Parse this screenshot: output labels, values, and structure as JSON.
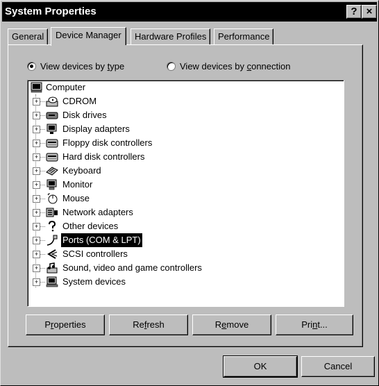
{
  "window": {
    "title": "System Properties"
  },
  "titlebar_buttons": {
    "help": "?",
    "close": "×"
  },
  "tabs": [
    {
      "label": "General"
    },
    {
      "label": "Device Manager"
    },
    {
      "label": "Hardware Profiles"
    },
    {
      "label": "Performance"
    }
  ],
  "view": {
    "by_type": {
      "pre": "View devices by ",
      "accel": "t",
      "post": "ype",
      "selected": true
    },
    "by_connection": {
      "pre": "View devices by ",
      "accel": "c",
      "post": "onnection",
      "selected": false
    }
  },
  "tree": {
    "root": {
      "label": "Computer",
      "icon": "computer-icon"
    },
    "items": [
      {
        "label": "CDROM",
        "icon": "cdrom-icon"
      },
      {
        "label": "Disk drives",
        "icon": "disk-drive-icon"
      },
      {
        "label": "Display adapters",
        "icon": "display-adapter-icon"
      },
      {
        "label": "Floppy disk controllers",
        "icon": "floppy-controller-icon"
      },
      {
        "label": "Hard disk controllers",
        "icon": "hard-disk-controller-icon"
      },
      {
        "label": "Keyboard",
        "icon": "keyboard-icon"
      },
      {
        "label": "Monitor",
        "icon": "monitor-icon"
      },
      {
        "label": "Mouse",
        "icon": "mouse-icon"
      },
      {
        "label": "Network adapters",
        "icon": "network-adapter-icon"
      },
      {
        "label": "Other devices",
        "icon": "question-mark-icon"
      },
      {
        "label": "Ports (COM & LPT)",
        "icon": "port-icon",
        "selected": true
      },
      {
        "label": "SCSI controllers",
        "icon": "scsi-icon"
      },
      {
        "label": "Sound, video and game controllers",
        "icon": "sound-icon"
      },
      {
        "label": "System devices",
        "icon": "system-devices-icon"
      }
    ]
  },
  "buttons": {
    "properties": {
      "pre": "P",
      "accel": "r",
      "post": "operties"
    },
    "refresh": {
      "pre": "Re",
      "accel": "f",
      "post": "resh"
    },
    "remove": {
      "pre": "R",
      "accel": "e",
      "post": "move"
    },
    "print": {
      "pre": "Pri",
      "accel": "n",
      "post": "t..."
    },
    "ok": "OK",
    "cancel": "Cancel"
  }
}
